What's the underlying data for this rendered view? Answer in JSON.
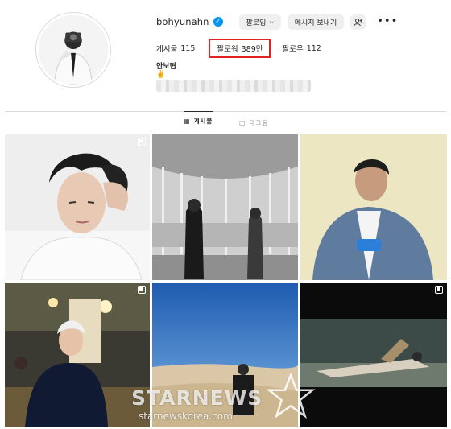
{
  "profile": {
    "username": "bohyunahn",
    "verified_icon": "verified-badge-icon",
    "display_name": "안보현",
    "bio_emoji": "✌️"
  },
  "actions": {
    "following_label": "팔로잉",
    "message_label": "메시지 보내기",
    "add_user_icon": "add-person-icon",
    "more_icon": "more-icon"
  },
  "stats": {
    "posts_label": "게시물",
    "posts_count": "115",
    "followers_label": "팔로워",
    "followers_count": "389만",
    "following_label": "팔로우",
    "following_count": "112"
  },
  "tabs": [
    {
      "label": "게시물",
      "icon": "grid-icon",
      "active": true
    },
    {
      "label": "태그됨",
      "icon": "tagged-icon",
      "active": false
    }
  ],
  "colors": {
    "highlight_box": "#e32121",
    "verified": "#0095f6",
    "button_bg": "#efefef"
  },
  "watermark": {
    "main": "STARNEWS",
    "sub": "starnewskorea.com"
  }
}
